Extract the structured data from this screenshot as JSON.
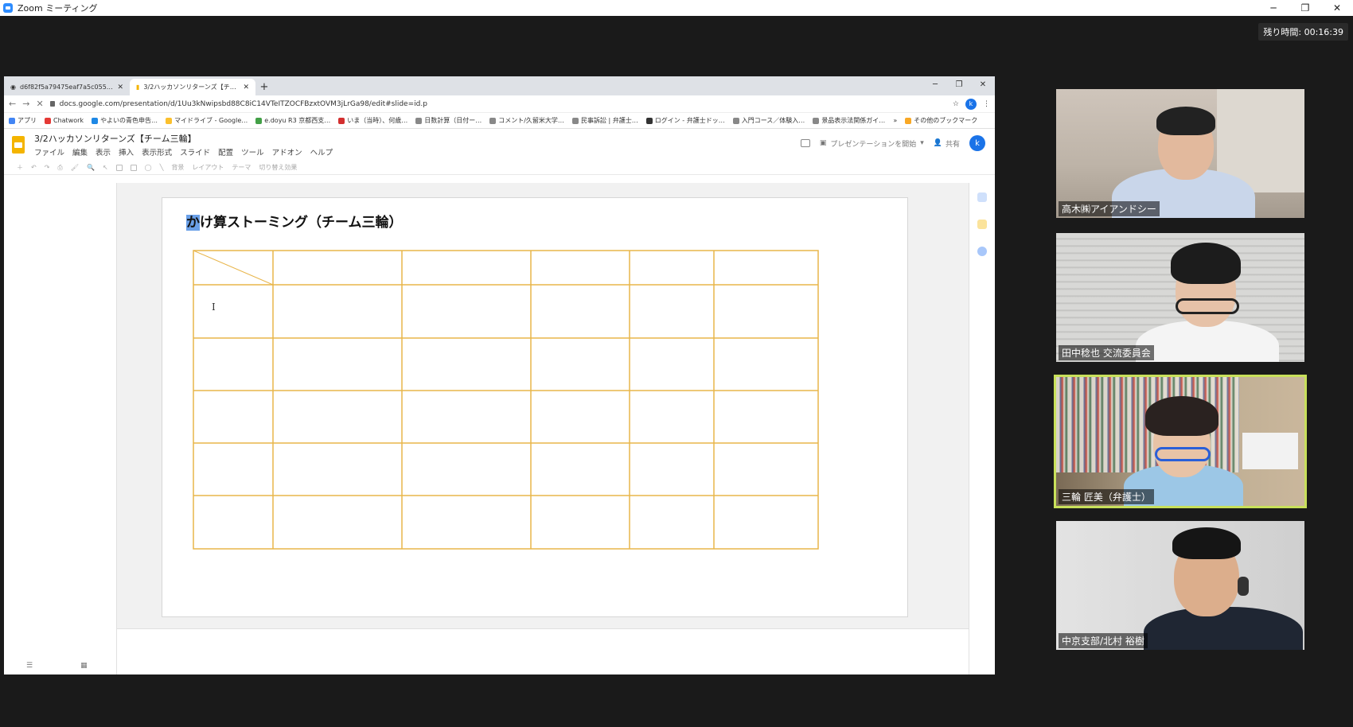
{
  "zoom": {
    "title": "Zoom ミーティング",
    "timer": "残り時間:  00:16:39",
    "controls": [
      "─",
      "❐",
      "✕"
    ]
  },
  "browser": {
    "tabs": [
      {
        "label": "d6f82f5a79475eaf7a5c055218cd",
        "active": false
      },
      {
        "label": "3/2ハッカソンリターンズ【チーム三輪】",
        "active": true
      }
    ],
    "new_tab": "+",
    "window_controls": [
      "─",
      "❐",
      "✕"
    ],
    "url": "docs.google.com/presentation/d/1Uu3kNwipsbd88C8iC14VTeITZOCFBzxtOVM3jLrGa98/edit#slide=id.p",
    "profile_initial": "k",
    "bookmarks": [
      "アプリ",
      "Chatwork",
      "やよいの青色申告…",
      "マイドライブ - Google…",
      "e.doyu R3 京都西支…",
      "いま（当時）、何歳…",
      "日数計算（日付ー…",
      "コメント/久留米大学…",
      "民事訴訟 | 弁護士…",
      "ログイン - 弁護士ドッ…",
      "入門コース／体験入…",
      "景品表示法関係ガイ…",
      "»",
      "その他のブックマーク"
    ]
  },
  "slides": {
    "doc_title": "3/2ハッカソンリターンズ【チーム三輪】",
    "menus": [
      "ファイル",
      "編集",
      "表示",
      "挿入",
      "表示形式",
      "スライド",
      "配置",
      "ツール",
      "アドオン",
      "ヘルプ"
    ],
    "present_label": "プレゼンテーションを開始",
    "share_label": "共有",
    "profile_initial": "k",
    "toolbar_items": [
      "背景",
      "レイアウト",
      "テーマ",
      "切り替え効果"
    ],
    "slide_title_selected": "か",
    "slide_title_rest": "け算ストーミング（チーム三輪）",
    "table": {
      "rows": 6,
      "cols": 6
    }
  },
  "participants": [
    {
      "name": "高木㈱アイアンドシー",
      "active": false
    },
    {
      "name": "田中稔也 交流委員会",
      "active": false
    },
    {
      "name": "三輪 匠美（弁護士）",
      "active": true
    },
    {
      "name": "中京支部/北村  裕樹",
      "active": false
    }
  ],
  "colors": {
    "table_border": "#e8b54a",
    "active_speaker": "#c8e05a",
    "accent": "#1a73e8"
  }
}
